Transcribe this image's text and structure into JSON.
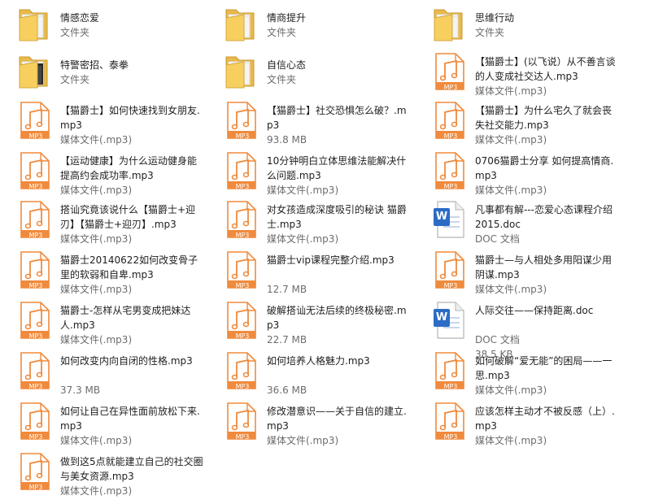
{
  "colors": {
    "folder": "#f6cf5f",
    "audio": "#f08a3c",
    "doc_blue": "#2b6cc4",
    "text": "#1e1e1e",
    "subtext": "#6d6d6d"
  },
  "items": [
    {
      "name": "情感恋爱",
      "type": "文件夹",
      "size": "",
      "icon": "folder-icon"
    },
    {
      "name": "情商提升",
      "type": "文件夹",
      "size": "",
      "icon": "folder-icon"
    },
    {
      "name": "思维行动",
      "type": "文件夹",
      "size": "",
      "icon": "folder-icon"
    },
    {
      "name": "特警密招、泰拳",
      "type": "文件夹",
      "size": "",
      "icon": "folder-dark-icon"
    },
    {
      "name": "自信心态",
      "type": "文件夹",
      "size": "",
      "icon": "folder-icon"
    },
    {
      "name": "【猫爵士】(以飞说）从不善言谈的人变成社交达人.mp3",
      "type": "媒体文件(.mp3)",
      "size": "",
      "icon": "mp3-file-icon"
    },
    {
      "name": "【猫爵士】如何快速找到女朋友.mp3",
      "type": "媒体文件(.mp3)",
      "size": "",
      "icon": "mp3-file-icon"
    },
    {
      "name": "【猫爵士】社交恐惧怎么破？.mp3",
      "type": "",
      "size": "93.8 MB",
      "icon": "mp3-file-icon"
    },
    {
      "name": "【猫爵士】为什么宅久了就会丧失社交能力.mp3",
      "type": "媒体文件(.mp3)",
      "size": "",
      "icon": "mp3-file-icon"
    },
    {
      "name": "【运动健康】为什么运动健身能提高约会成功率.mp3",
      "type": "媒体文件(.mp3)",
      "size": "",
      "icon": "mp3-file-icon"
    },
    {
      "name": "10分钟明白立体思维法能解决什么问题.mp3",
      "type": "媒体文件(.mp3)",
      "size": "",
      "icon": "mp3-file-icon"
    },
    {
      "name": "0706猫爵士分享 如何提高情商.mp3",
      "type": "媒体文件(.mp3)",
      "size": "",
      "icon": "mp3-file-icon"
    },
    {
      "name": "搭讪究竟该说什么【猫爵士+迎刃】【猫爵士+迎刃】.mp3",
      "type": "媒体文件(.mp3)",
      "size": "",
      "icon": "mp3-file-icon"
    },
    {
      "name": "对女孩造成深度吸引的秘诀 猫爵士.mp3",
      "type": "媒体文件(.mp3)",
      "size": "",
      "icon": "mp3-file-icon"
    },
    {
      "name": "凡事都有解---恋爱心态课程介绍2015.doc",
      "type": "DOC 文档",
      "size": "",
      "icon": "word-doc-icon"
    },
    {
      "name": "猫爵士20140622如何改变骨子里的软弱和自卑.mp3",
      "type": "媒体文件(.mp3)",
      "size": "",
      "icon": "mp3-file-icon"
    },
    {
      "name": "猫爵士vip课程完整介绍.mp3",
      "type": "",
      "size": "12.7 MB",
      "icon": "mp3-file-icon"
    },
    {
      "name": "猫爵士—与人相处多用阳谋少用阴谋.mp3",
      "type": "媒体文件(.mp3)",
      "size": "",
      "icon": "mp3-file-icon"
    },
    {
      "name": "猫爵士-怎样从宅男变成把妹达人.mp3",
      "type": "媒体文件(.mp3)",
      "size": "",
      "icon": "mp3-file-icon"
    },
    {
      "name": "破解搭讪无法后续的终极秘密.mp3",
      "type": "",
      "size": "22.7 MB",
      "icon": "mp3-file-icon"
    },
    {
      "name": "人际交往——保持距离.doc",
      "type": "DOC 文档",
      "size": "38.5 KB",
      "icon": "word-doc-icon"
    },
    {
      "name": "如何改变内向自闭的性格.mp3",
      "type": "",
      "size": "37.3 MB",
      "icon": "mp3-file-icon"
    },
    {
      "name": "如何培养人格魅力.mp3",
      "type": "",
      "size": "36.6 MB",
      "icon": "mp3-file-icon"
    },
    {
      "name": "如何破解“爱无能”的困局——一思.mp3",
      "type": "媒体文件(.mp3)",
      "size": "",
      "icon": "mp3-file-icon"
    },
    {
      "name": "如何让自己在异性面前放松下来.mp3",
      "type": "媒体文件(.mp3)",
      "size": "",
      "icon": "mp3-file-icon"
    },
    {
      "name": "修改潜意识——关于自信的建立.mp3",
      "type": "媒体文件(.mp3)",
      "size": "",
      "icon": "mp3-file-icon"
    },
    {
      "name": "应该怎样主动才不被反感（上）.mp3",
      "type": "媒体文件(.mp3)",
      "size": "",
      "icon": "mp3-file-icon"
    },
    {
      "name": "做到这5点就能建立自己的社交圈与美女资源.mp3",
      "type": "媒体文件(.mp3)",
      "size": "",
      "icon": "mp3-file-icon"
    }
  ],
  "mp3_label": "MP3",
  "doc_label": "W"
}
